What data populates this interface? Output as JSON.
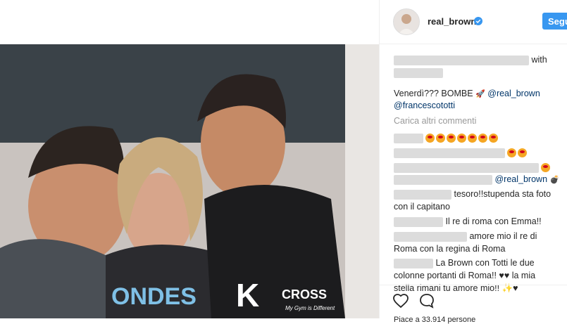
{
  "post": {
    "username": "real_brown",
    "follow_label": "Segui",
    "caption_with": "with",
    "caption_text": "Venerdì??? BOMBE",
    "mention_brown": "@real_brown",
    "mention_totti": "@francescototti",
    "load_more": "Carica altri commenti",
    "likes_text": "Piace a 33.914 persone",
    "photo_shirt_left": "ONDES",
    "photo_shirt_brand": "CROSS",
    "photo_shirt_tagline": "My Gym is Different"
  },
  "comments": [
    {
      "text": ""
    },
    {
      "text": ""
    },
    {
      "text": "@real_brown"
    },
    {
      "text": "tesoro!!stupenda sta foto"
    },
    {
      "text": "con il capitano"
    },
    {
      "text": "Il re di roma con Emma!!"
    },
    {
      "text": "amore mio il re di"
    },
    {
      "text": "Roma con la regina di Roma"
    },
    {
      "text": "La Brown con Totti le due"
    },
    {
      "text": "colonne portanti di Roma!!"
    },
    {
      "text": "la mia"
    },
    {
      "text": "stella rimani tu amore mio!!"
    }
  ],
  "icons": {
    "like": "heart-icon",
    "comment": "comment-icon",
    "verified": "verified-badge-icon"
  },
  "colors": {
    "accent": "#3897f0",
    "link": "#003569"
  }
}
